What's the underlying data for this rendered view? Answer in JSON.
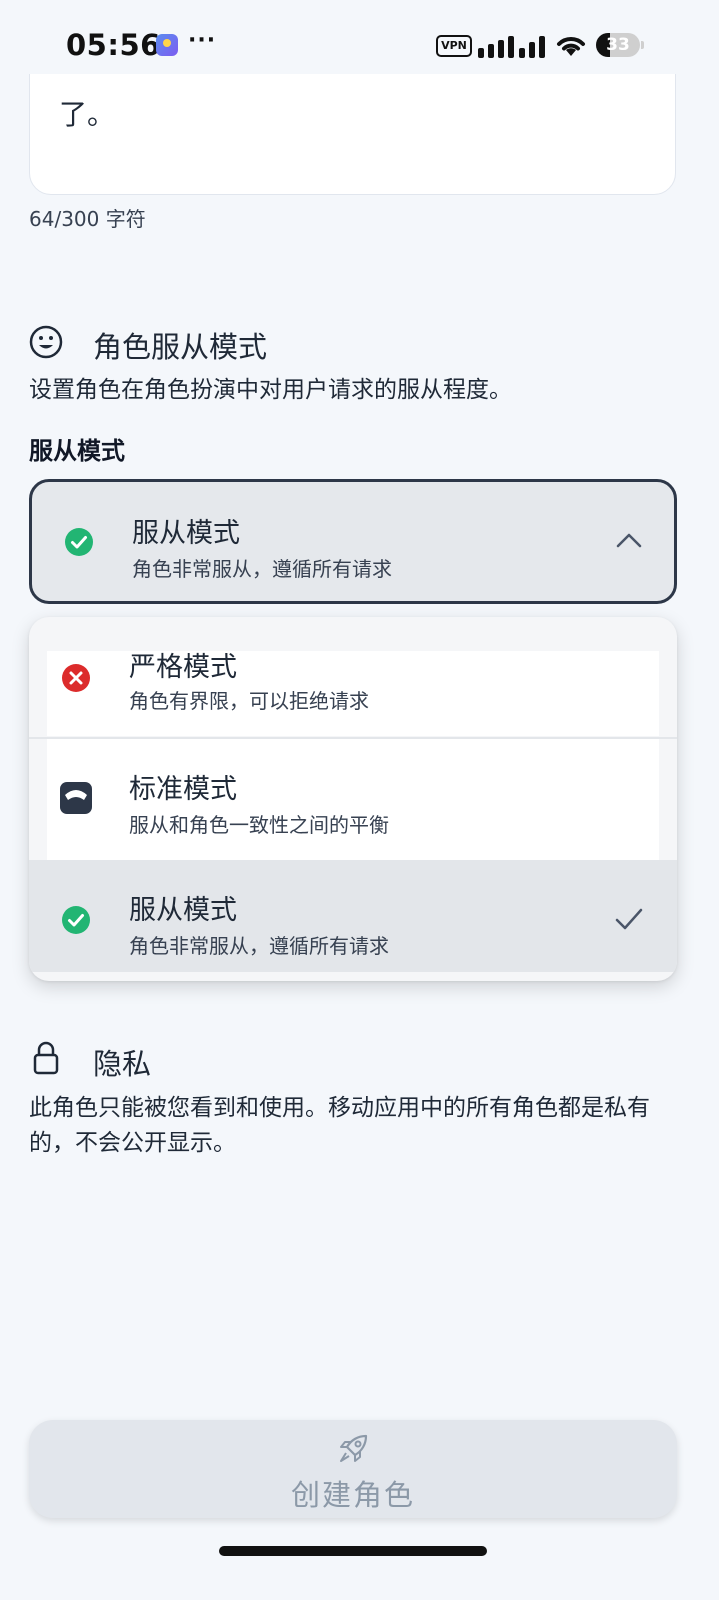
{
  "status_bar": {
    "time": "05:56",
    "overflow_dots": "···",
    "vpn_label": "VPN",
    "battery_level": "33",
    "icons": [
      "app-icon",
      "vpn-icon",
      "signal-icon",
      "wifi-icon",
      "battery-icon"
    ]
  },
  "description_field": {
    "visible_text": "了。",
    "char_count": "64/300 字符"
  },
  "compliance_section": {
    "icon": "smiley-icon",
    "title": "角色服从模式",
    "description": "设置角色在角色扮演中对用户请求的服从程度。",
    "field_label": "服从模式",
    "selected": {
      "title": "服从模式",
      "subtitle": "角色非常服从，遵循所有请求",
      "icon": "green-check-circle-icon"
    },
    "options": [
      {
        "title": "严格模式",
        "subtitle": "角色有界限，可以拒绝请求",
        "icon": "red-x-circle-icon",
        "selected": false
      },
      {
        "title": "标准模式",
        "subtitle": "服从和角色一致性之间的平衡",
        "icon": "scale-icon",
        "selected": false
      },
      {
        "title": "服从模式",
        "subtitle": "角色非常服从，遵循所有请求",
        "icon": "green-check-circle-icon",
        "selected": true
      }
    ]
  },
  "privacy_section": {
    "icon": "lock-icon",
    "title": "隐私",
    "description": "此角色只能被您看到和使用。移动应用中的所有角色都是私有的，不会公开显示。"
  },
  "create_button": {
    "label": "创建角色",
    "icon": "rocket-icon"
  },
  "colors": {
    "background": "#f4f7fb",
    "success_green": "#22b573",
    "error_red": "#dc2b2b",
    "dark_slate": "#2d3748",
    "button_text_muted": "#8c99a8"
  }
}
